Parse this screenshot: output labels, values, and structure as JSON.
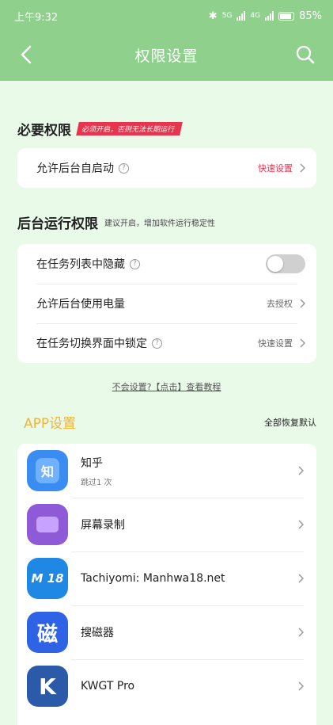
{
  "status": {
    "time": "上午9:32",
    "network1": "5G",
    "network2": "4G",
    "battery": "85"
  },
  "header": {
    "title": "权限设置"
  },
  "required": {
    "title": "必要权限",
    "tag": "必须开启，否则无法长期运行",
    "row": {
      "label": "允许后台自启动",
      "action": "快速设置"
    }
  },
  "background": {
    "title": "后台运行权限",
    "hint": "建议开启，增加软件运行稳定性",
    "rows": [
      {
        "label": "在任务列表中隐藏",
        "toggle": "off"
      },
      {
        "label": "允许后台使用电量",
        "action": "去授权"
      },
      {
        "label": "在任务切换界面中锁定",
        "action": "快速设置"
      }
    ]
  },
  "tutorial": "不会设置?【点击】查看教程",
  "apps": {
    "title": "APP设置",
    "restore": "全部恢复默认",
    "list": [
      {
        "name": "知乎",
        "sub": "跳过1 次",
        "icon": "zhihu-icon",
        "icon_text": "知",
        "color": "#3b8cf0"
      },
      {
        "name": "屏幕录制",
        "sub": "",
        "icon": "screen-record-icon",
        "color": "#8e5ad8"
      },
      {
        "name": "Tachiyomi: Manhwa18.net",
        "sub": "",
        "icon": "tachiyomi-icon",
        "icon_text": "M 18",
        "color": "#1f88e5"
      },
      {
        "name": "搜磁器",
        "sub": "",
        "icon": "magnet-search-icon",
        "icon_text": "磁",
        "color": "#2f63e6"
      },
      {
        "name": "KWGT Pro",
        "sub": "",
        "icon": "kwgt-icon",
        "icon_text": "K",
        "color": "#2a5aa8"
      }
    ]
  },
  "colors": {
    "header_bg": "#8fd18c",
    "page_bg": "#e9fae9",
    "accent_red": "#e8344c",
    "accent_orange": "#f0b43c"
  }
}
